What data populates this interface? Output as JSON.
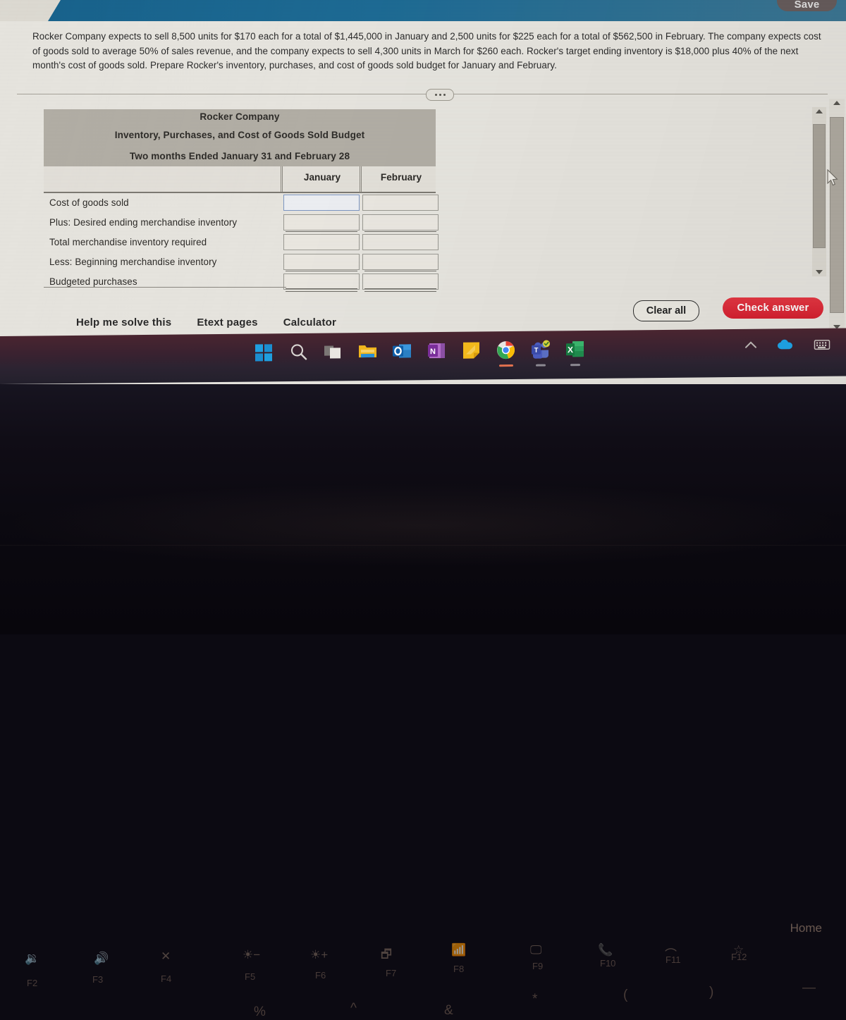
{
  "app": {
    "save_label": "Save"
  },
  "problem": {
    "text": "Rocker Company expects to sell 8,500 units for $170 each for a total of $1,445,000 in January and 2,500 units for $225 each for a total of $562,500 in February. The company expects cost of goods sold to average 50% of sales revenue, and the company expects to sell 4,300 units in March for $260 each. Rocker's target ending inventory is $18,000 plus 40% of the next month's cost of goods sold. Prepare Rocker's inventory, purchases, and cost of goods sold budget for January and February."
  },
  "worksheet": {
    "title_line1": "Rocker Company",
    "title_line2": "Inventory, Purchases, and Cost of Goods Sold Budget",
    "title_line3": "Two months Ended January 31 and February 28",
    "columns": [
      "January",
      "February"
    ],
    "rows": [
      {
        "label": "Cost of goods sold",
        "january": "",
        "february": ""
      },
      {
        "label": "Plus: Desired ending merchandise inventory",
        "january": "",
        "february": ""
      },
      {
        "label": "Total merchandise inventory required",
        "january": "",
        "february": ""
      },
      {
        "label": "Less: Beginning merchandise inventory",
        "january": "",
        "february": ""
      },
      {
        "label": "Budgeted purchases",
        "january": "",
        "february": ""
      }
    ]
  },
  "tools": {
    "links": [
      "Help me solve this",
      "Etext pages",
      "Calculator"
    ]
  },
  "actions": {
    "clear_all": "Clear all",
    "check_answer": "Check answer"
  },
  "taskbar": {
    "icons": [
      "windows-start-icon",
      "search-icon",
      "task-view-icon",
      "file-explorer-icon",
      "outlook-icon",
      "onenote-icon",
      "sticky-notes-icon",
      "chrome-icon",
      "teams-icon",
      "excel-icon"
    ],
    "tray": [
      "show-hidden-icons-chevron",
      "onedrive-icon",
      "touch-keyboard-icon"
    ]
  },
  "keyboard": {
    "fkeys": [
      "F3",
      "F4",
      "F5",
      "F6",
      "F7",
      "F8",
      "F9",
      "F10",
      "F11",
      "F12"
    ],
    "home_key": "Home",
    "symbols": [
      "%",
      "^",
      "&",
      "*",
      "(",
      ")",
      "—"
    ]
  },
  "colors": {
    "appbar_blue": "#1d6b95",
    "check_answer_red": "#d6202f",
    "sheet_header_grey": "#b3afa6",
    "screen_background": "#e8e6e0"
  }
}
